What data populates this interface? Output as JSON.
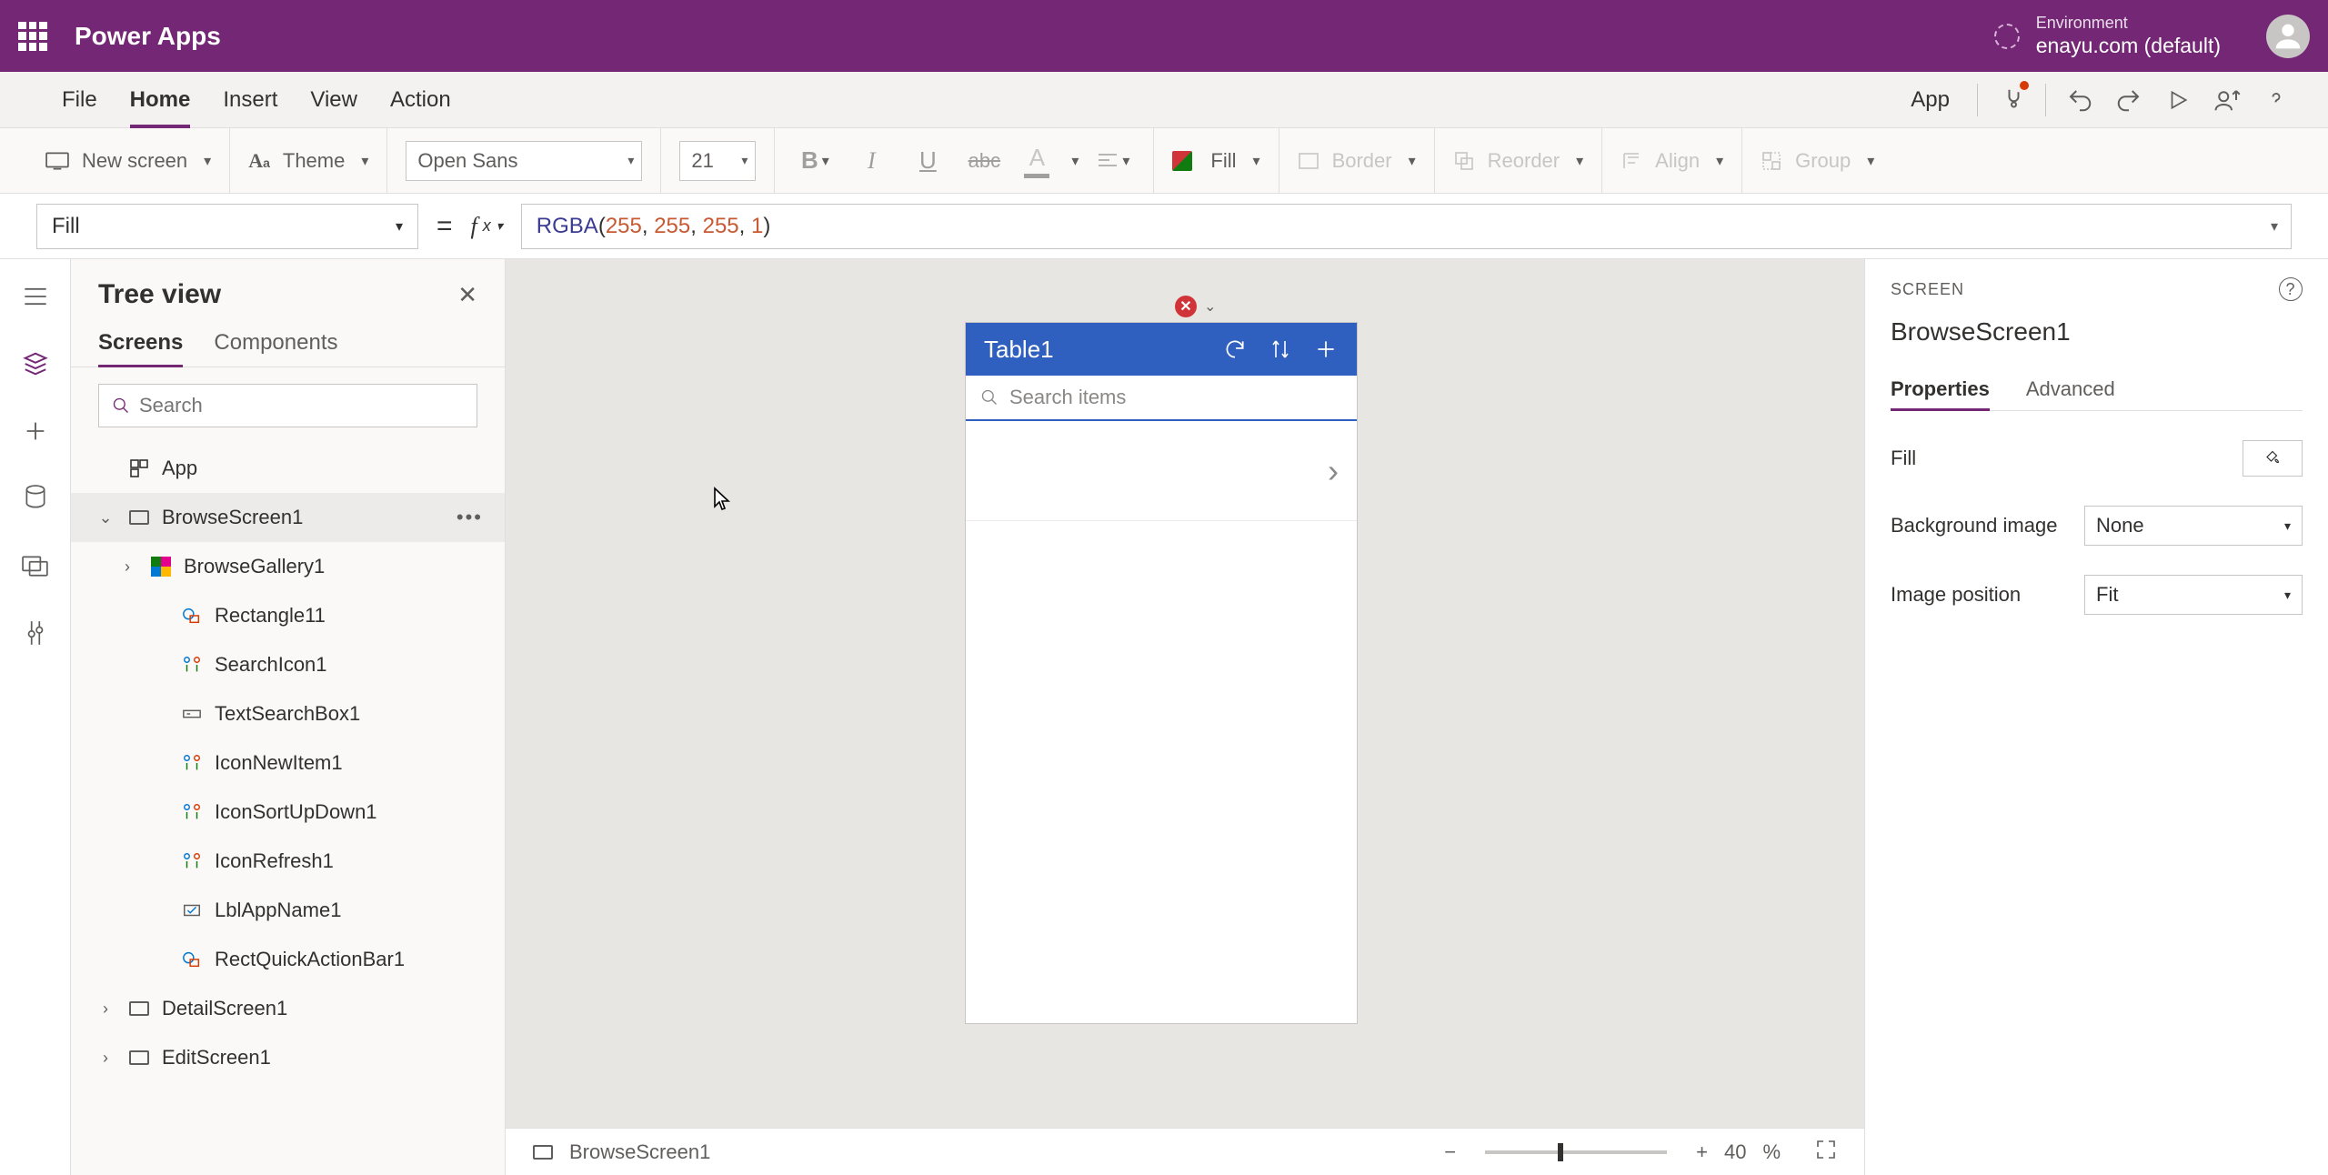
{
  "header": {
    "app_name": "Power Apps",
    "env_label": "Environment",
    "env_value": "enayu.com (default)"
  },
  "menus": {
    "file": "File",
    "home": "Home",
    "insert": "Insert",
    "view": "View",
    "action": "Action",
    "app": "App"
  },
  "ribbon": {
    "new_screen": "New screen",
    "theme": "Theme",
    "font": "Open Sans",
    "size": "21",
    "fill": "Fill",
    "border": "Border",
    "reorder": "Reorder",
    "align": "Align",
    "group": "Group"
  },
  "formula": {
    "property": "Fill",
    "fn": "RGBA",
    "a1": "255",
    "a2": "255",
    "a3": "255",
    "a4": "1"
  },
  "tree": {
    "title": "Tree view",
    "tab_screens": "Screens",
    "tab_components": "Components",
    "search_placeholder": "Search",
    "nodes": {
      "app": "App",
      "browse": "BrowseScreen1",
      "gallery": "BrowseGallery1",
      "rect11": "Rectangle11",
      "searchicon": "SearchIcon1",
      "textsearch": "TextSearchBox1",
      "iconnew": "IconNewItem1",
      "iconsort": "IconSortUpDown1",
      "iconrefresh": "IconRefresh1",
      "lblapp": "LblAppName1",
      "rectquick": "RectQuickActionBar1",
      "detail": "DetailScreen1",
      "edit": "EditScreen1"
    }
  },
  "canvas": {
    "app_title": "Table1",
    "search_placeholder": "Search items"
  },
  "status": {
    "screen": "BrowseScreen1",
    "zoom": "40",
    "pct": "%"
  },
  "props": {
    "eyebrow": "SCREEN",
    "name": "BrowseScreen1",
    "tab_props": "Properties",
    "tab_adv": "Advanced",
    "fill": "Fill",
    "bgimg": "Background image",
    "bgimg_val": "None",
    "imgpos": "Image position",
    "imgpos_val": "Fit"
  }
}
